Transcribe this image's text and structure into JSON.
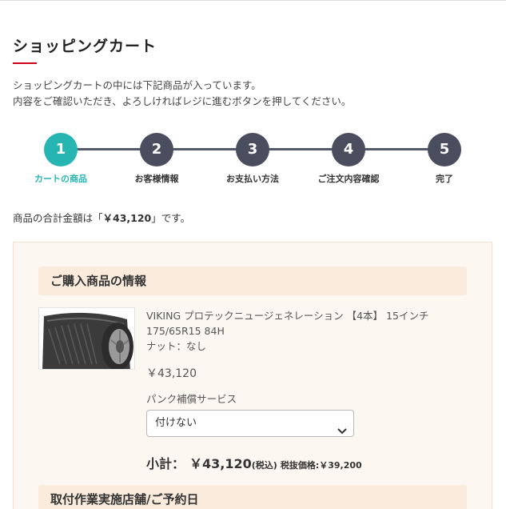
{
  "page": {
    "title": "ショッピングカート",
    "intro_line1": "ショッピングカートの中には下記商品が入っています。",
    "intro_line2": "内容をご確認いただき、よろしければレジに進むボタンを押してください。"
  },
  "steps": [
    {
      "number": "1",
      "label": "カートの商品",
      "active": true
    },
    {
      "number": "2",
      "label": "お客様情報",
      "active": false
    },
    {
      "number": "3",
      "label": "お支払い方法",
      "active": false
    },
    {
      "number": "4",
      "label": "ご注文内容確認",
      "active": false
    },
    {
      "number": "5",
      "label": "完了",
      "active": false
    }
  ],
  "summary": {
    "prefix": "商品の合計金額は「",
    "amount": "￥43,120",
    "suffix": "」です。"
  },
  "purchase": {
    "section_title": "ご購入商品の情報",
    "product_name_line1": "VIKING プロテックニュージェネレーション 【4本】 15インチ",
    "product_name_line2": "175/65R15 84H",
    "product_nut": "ナット：なし",
    "price": "￥43,120",
    "service_label": "パンク補償サービス",
    "service_selected": "付けない",
    "subtotal_label": "小計：",
    "subtotal_amount": "￥43,120",
    "subtotal_tax_note": "(税込)",
    "subtotal_ex_tax": "税抜価格:￥39,200"
  },
  "store": {
    "section_title": "取付作業実施店舗/ご予約日"
  },
  "colors": {
    "accent_teal": "#27b5b2",
    "step_inactive": "#4a4d5e",
    "title_underline": "#d0021b",
    "panel_bg": "#fdf7f1",
    "section_head_bg": "#faebdc"
  },
  "icons": {
    "select_arrow": "chevron-down-icon",
    "product_image": "tire-image"
  }
}
